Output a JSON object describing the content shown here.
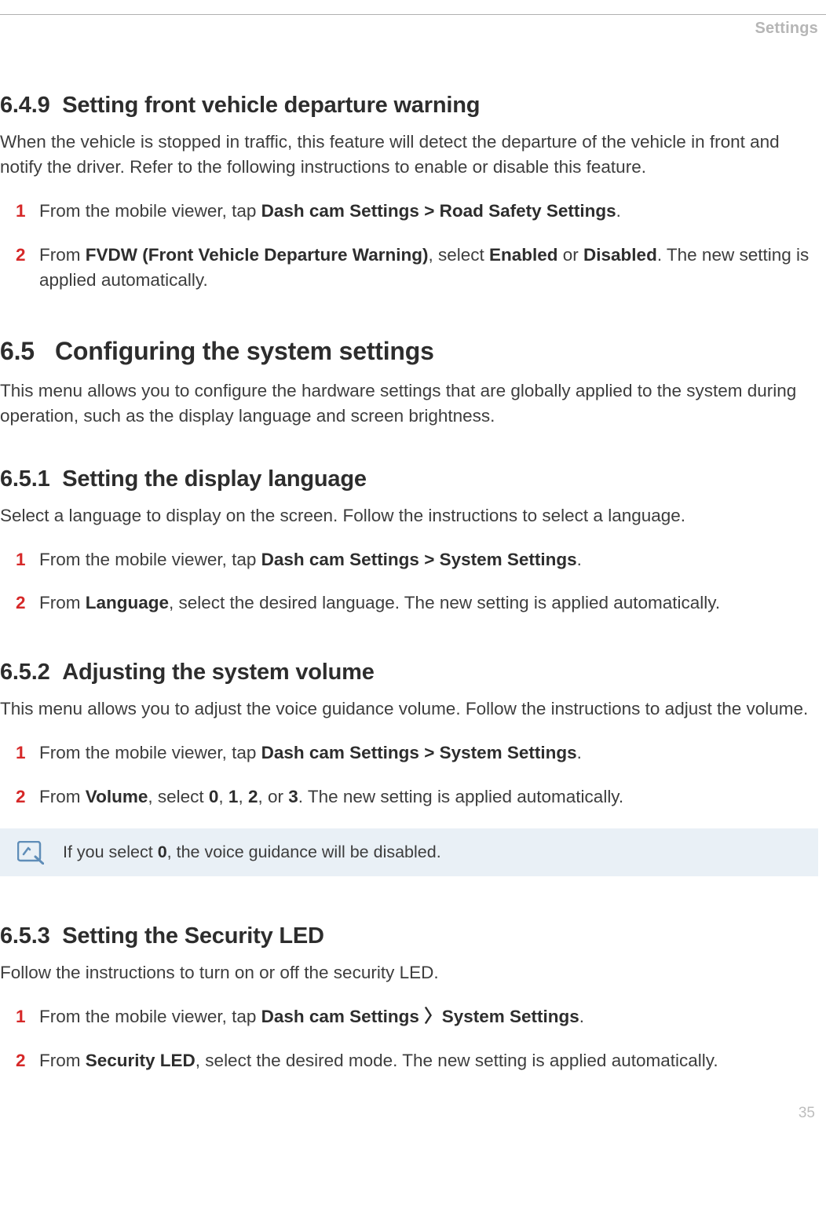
{
  "header": {
    "category": "Settings"
  },
  "page_number": "35",
  "s649": {
    "num": "6.4.9",
    "title": "Setting front vehicle departure warning",
    "intro": "When the vehicle is stopped in traffic, this feature will detect the departure of the vehicle in front and notify the driver. Refer to the following instructions to enable or disable this feature.",
    "step1": {
      "n": "1",
      "pre": "From the mobile viewer, tap ",
      "b1": "Dash cam Settings",
      "chev": " > ",
      "b2": "Road Safety Settings",
      "post": "."
    },
    "step2": {
      "n": "2",
      "pre": "From ",
      "b1": "FVDW (Front Vehicle Departure Warning)",
      "mid1": ", select ",
      "b2": "Enabled",
      "mid2": " or ",
      "b3": "Disabled",
      "post": ". The new setting is applied automatically."
    }
  },
  "s65": {
    "num": "6.5",
    "title": "Configuring the system settings",
    "intro": "This menu allows you to configure the hardware settings that are globally applied to the system during operation, such as the display language and screen brightness."
  },
  "s651": {
    "num": "6.5.1",
    "title": "Setting the display language",
    "intro": "Select a language to display on the screen. Follow the instructions to select a language.",
    "step1": {
      "n": "1",
      "pre": "From the mobile viewer, tap ",
      "b1": "Dash cam Settings",
      "chev": " > ",
      "b2": "System Settings",
      "post": "."
    },
    "step2": {
      "n": "2",
      "pre": "From ",
      "b1": "Language",
      "post": ", select the desired language. The new setting is applied automatically."
    }
  },
  "s652": {
    "num": "6.5.2",
    "title": "Adjusting the system volume",
    "intro": "This menu allows you to adjust the voice guidance volume. Follow the instructions to adjust the volume.",
    "step1": {
      "n": "1",
      "pre": "From the mobile viewer, tap ",
      "b1": "Dash cam Settings",
      "chev": " > ",
      "b2": "System Settings",
      "post": "."
    },
    "step2": {
      "n": "2",
      "pre": "From ",
      "b1": "Volume",
      "mid1": ", select ",
      "v0": "0",
      "c1": ", ",
      "v1": "1",
      "c2": ", ",
      "v2": "2",
      "c3": ", or ",
      "v3": "3",
      "post": ". The new setting is applied automatically."
    },
    "note": {
      "pre": "If you select ",
      "b1": "0",
      "post": ", the voice guidance will be disabled."
    }
  },
  "s653": {
    "num": "6.5.3",
    "title": "Setting the Security LED",
    "intro": "Follow the instructions to turn on or off the security LED.",
    "step1": {
      "n": "1",
      "pre": "From the mobile viewer, tap ",
      "b1": "Dash cam Settings",
      "chev": " 〉",
      "b2": "System Settings",
      "post": "."
    },
    "step2": {
      "n": "2",
      "pre": "From ",
      "b1": "Security LED",
      "post": ", select the desired mode. The new setting is applied automatically."
    }
  }
}
